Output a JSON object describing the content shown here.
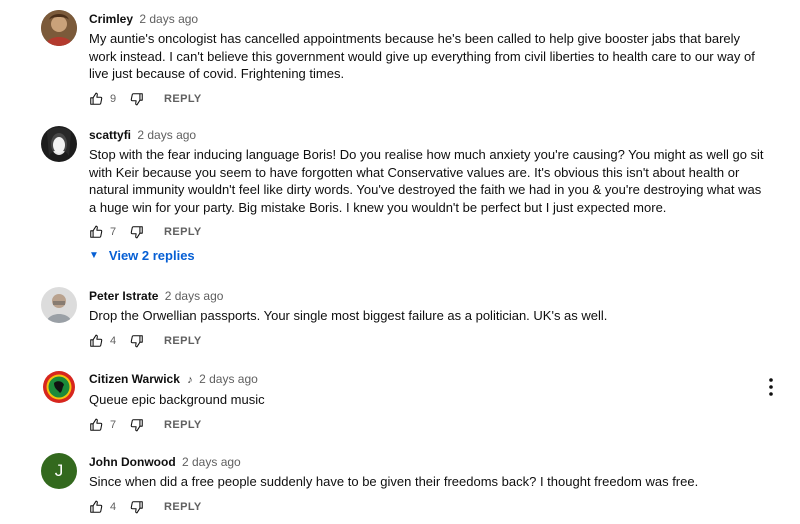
{
  "comments": [
    {
      "author": "Crimley",
      "time": "2 days ago",
      "text": "My auntie's oncologist has cancelled appointments because he's been called to help give booster jabs that barely work instead. I can't believe this government would give up everything from civil liberties to health care to our way of live just because of covid. Frightening times.",
      "likes": "9",
      "reply_label": "REPLY"
    },
    {
      "author": "scattyfi",
      "time": "2 days ago",
      "text": "Stop with the fear inducing language Boris! Do you realise how much anxiety you're causing? You might as well go sit with Keir because you seem to have forgotten what Conservative values are. It's obvious this isn't about health or natural immunity wouldn't feel like dirty words. You've destroyed the faith we had in you & you're destroying what was a huge win for your party. Big mistake Boris. I knew you wouldn't be perfect but I just expected more.",
      "likes": "7",
      "reply_label": "REPLY",
      "view_replies": "View 2 replies"
    },
    {
      "author": "Peter Istrate",
      "time": "2 days ago",
      "text": "Drop the Orwellian passports. Your single most biggest failure as a politician. UK's as well.",
      "likes": "4",
      "reply_label": "REPLY"
    },
    {
      "author": "Citizen Warwick",
      "time": "2 days ago",
      "text": "Queue epic background music",
      "likes": "7",
      "reply_label": "REPLY"
    },
    {
      "author": "John Donwood",
      "time": "2 days ago",
      "text": "Since when did a free people suddenly have to be given their freedoms back? I thought freedom was free.",
      "likes": "4",
      "reply_label": "REPLY",
      "avatar_letter": "J"
    }
  ],
  "colors": {
    "link": "#065fd4",
    "muted": "#606060",
    "avatar_j": "#33691e"
  },
  "icons": [
    "thumbs-up-icon",
    "thumbs-down-icon",
    "chevron-down-icon",
    "music-note-icon",
    "more-vert-icon"
  ]
}
